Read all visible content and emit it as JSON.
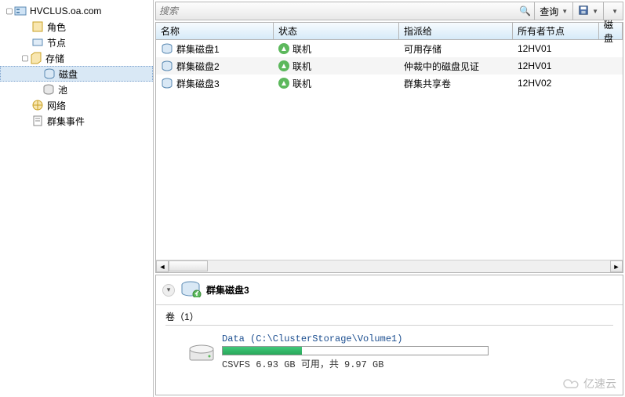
{
  "tree": {
    "root": "HVCLUS.oa.com",
    "roles": "角色",
    "nodes": "节点",
    "storage": "存储",
    "disks": "磁盘",
    "pools": "池",
    "network": "网络",
    "events": "群集事件"
  },
  "toolbar": {
    "search_placeholder": "搜索",
    "query": "查询"
  },
  "grid": {
    "headers": {
      "name": "名称",
      "status": "状态",
      "assigned": "指派给",
      "owner": "所有者节点",
      "disk": "磁盘"
    },
    "rows": [
      {
        "name": "群集磁盘1",
        "status": "联机",
        "assigned": "可用存储",
        "owner": "12HV01"
      },
      {
        "name": "群集磁盘2",
        "status": "联机",
        "assigned": "仲裁中的磁盘见证",
        "owner": "12HV01"
      },
      {
        "name": "群集磁盘3",
        "status": "联机",
        "assigned": "群集共享卷",
        "owner": "12HV02"
      }
    ]
  },
  "detail": {
    "title": "群集磁盘3",
    "volumes_label": "卷（1）",
    "volume_path": "Data (C:\\ClusterStorage\\Volume1)",
    "volume_usage": "CSVFS 6.93 GB 可用，共 9.97 GB"
  },
  "watermark": "亿速云"
}
